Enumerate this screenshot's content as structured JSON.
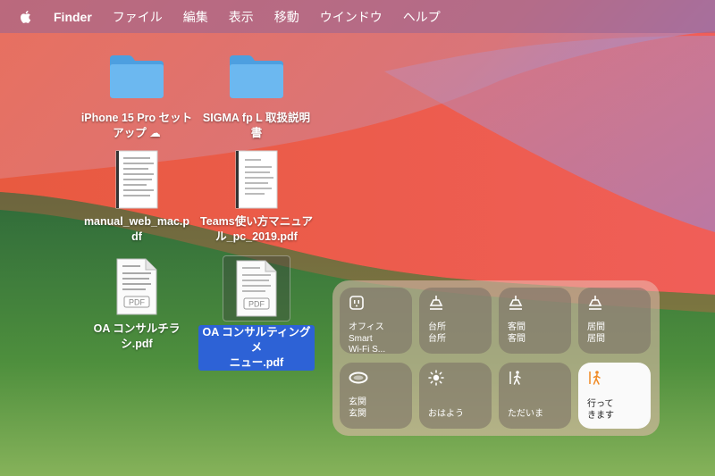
{
  "menubar": {
    "app_name": "Finder",
    "items": [
      "ファイル",
      "編集",
      "表示",
      "移動",
      "ウインドウ",
      "ヘルプ"
    ]
  },
  "desktop": {
    "items": [
      {
        "name": "iPhone 15 Pro セットアップ",
        "line1": "iPhone 15 Pro セット",
        "line2": "アップ ☁",
        "kind": "folder"
      },
      {
        "name": "SIGMA fp L 取扱説明書",
        "line1": "SIGMA fp L 取扱説明",
        "line2": "書",
        "kind": "folder"
      },
      {
        "name": "manual_web_mac.pdf",
        "line1": "manual_web_mac.p",
        "line2": "df",
        "kind": "pdf"
      },
      {
        "name": "Teams使い方マニュアル_pc_2019.pdf",
        "line1": "Teams使い方マニュア",
        "line2": "ル_pc_2019.pdf",
        "kind": "pdf"
      },
      {
        "name": "OAコンサルチラシ.pdf",
        "line1": "OA コンサルチラ",
        "line2": "シ.pdf",
        "kind": "pdf",
        "badge": "PDF"
      },
      {
        "name": "OAコンサルティングメニュー.pdf",
        "line1": "OA コンサルティングメ",
        "line2": "ニュー.pdf",
        "kind": "pdf",
        "badge": "PDF",
        "selected": true
      }
    ]
  },
  "home_widget": {
    "tiles": [
      {
        "icon": "outlet-icon",
        "lines": [
          "オフィス",
          "Smart",
          "Wi-Fi S..."
        ]
      },
      {
        "icon": "ceiling-light-icon",
        "lines": [
          "台所",
          "台所"
        ]
      },
      {
        "icon": "ceiling-light-icon",
        "lines": [
          "客間",
          "客間"
        ]
      },
      {
        "icon": "ceiling-light-icon",
        "lines": [
          "居間",
          "居間"
        ]
      },
      {
        "icon": "ring-light-icon",
        "lines": [
          "玄関",
          "玄関"
        ]
      },
      {
        "icon": "sun-icon",
        "lines": [
          "おはよう"
        ]
      },
      {
        "icon": "person-arriving-icon",
        "lines": [
          "ただいま"
        ]
      },
      {
        "icon": "person-leaving-icon",
        "lines": [
          "行って",
          "きます"
        ],
        "active": true
      }
    ]
  },
  "colors": {
    "selection_blue": "#2d62d6",
    "folder_blue": "#5aaee8",
    "leaving_icon_orange": "#f08a24"
  }
}
